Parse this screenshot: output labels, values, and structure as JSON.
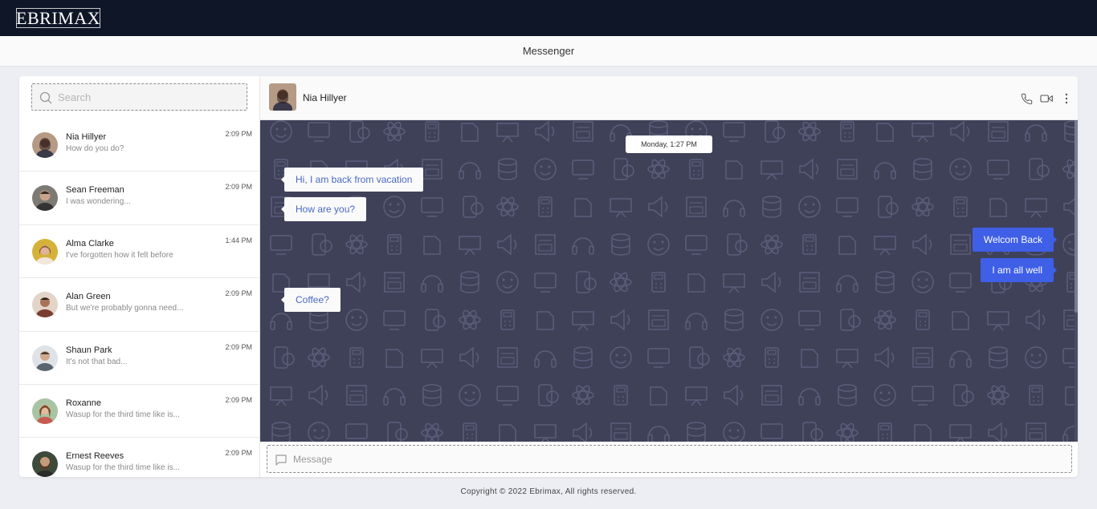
{
  "brand": {
    "logo_text": "EBRIMAX"
  },
  "header": {
    "title": "Messenger"
  },
  "search": {
    "placeholder": "Search",
    "icon": "search-icon"
  },
  "contacts": [
    {
      "name": "Nia Hillyer",
      "preview": "How do you do?",
      "time": "2:09 PM"
    },
    {
      "name": "Sean Freeman",
      "preview": "I was wondering...",
      "time": "2:09 PM"
    },
    {
      "name": "Alma Clarke",
      "preview": "I've forgotten how it felt before",
      "time": "1:44 PM"
    },
    {
      "name": "Alan Green",
      "preview": "But we're probably gonna need...",
      "time": "2:09 PM"
    },
    {
      "name": "Shaun Park",
      "preview": "It's not that bad...",
      "time": "2:09 PM"
    },
    {
      "name": "Roxanne",
      "preview": "Wasup for the third time like is...",
      "time": "2:09 PM"
    },
    {
      "name": "Ernest Reeves",
      "preview": "Wasup for the third time like is...",
      "time": "2:09 PM"
    }
  ],
  "chat": {
    "contact_name": "Nia Hillyer",
    "header_icons": [
      "phone-icon",
      "video-icon",
      "more-vertical-icon"
    ],
    "date_divider": "Monday, 1:27 PM",
    "messages": [
      {
        "direction": "in",
        "text": "Hi, I am back from vacation"
      },
      {
        "direction": "in",
        "text": "How are you?"
      },
      {
        "direction": "out",
        "text": "Welcom Back"
      },
      {
        "direction": "out",
        "text": "I am all well"
      },
      {
        "direction": "in",
        "text": "Coffee?"
      }
    ],
    "composer_placeholder": "Message",
    "composer_icon": "message-icon"
  },
  "footer": {
    "copyright": "Copyright © 2022 Ebrimax, All rights reserved."
  },
  "colors": {
    "topbar": "#0e1628",
    "chat_background": "#3f4159",
    "outgoing_bubble": "#3e5fe6",
    "incoming_text": "#4a6ac4"
  }
}
